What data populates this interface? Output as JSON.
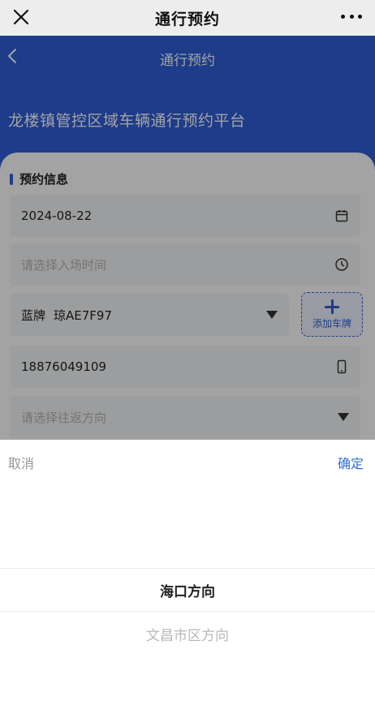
{
  "wechat_bar": {
    "title": "通行预约"
  },
  "header": {
    "nav_title": "通行预约",
    "hero_title": "龙楼镇管控区域车辆通行预约平台"
  },
  "form": {
    "section_title": "预约信息",
    "date_value": "2024-08-22",
    "time_placeholder": "请选择入场时间",
    "plate_color": "蓝牌",
    "plate_number": "琼AE7F97",
    "add_plate_label": "添加车牌",
    "phone_value": "18876049109",
    "direction_placeholder": "请选择往返方向"
  },
  "picker": {
    "cancel_label": "取消",
    "confirm_label": "确定",
    "options": [
      "海口方向",
      "文昌市区方向"
    ],
    "selected_index": 0
  },
  "colors": {
    "primary": "#2f5fd7",
    "confirm": "#2f6fd0",
    "mask": "rgba(0,0,0,0.36)"
  }
}
